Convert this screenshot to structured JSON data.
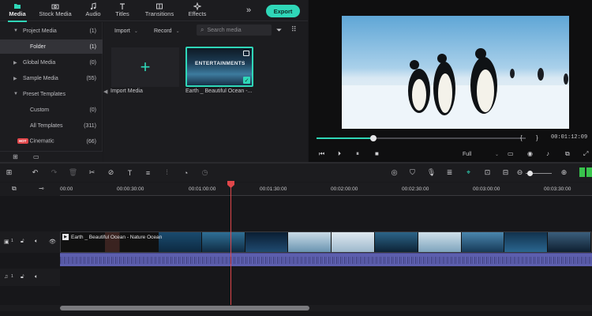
{
  "tabs": [
    {
      "label": "Media",
      "icon": "folder-icon",
      "active": true
    },
    {
      "label": "Stock Media",
      "icon": "camera-icon",
      "active": false
    },
    {
      "label": "Audio",
      "icon": "music-note-icon",
      "active": false
    },
    {
      "label": "Titles",
      "icon": "text-t-icon",
      "active": false
    },
    {
      "label": "Transitions",
      "icon": "transition-icon",
      "active": false
    },
    {
      "label": "Effects",
      "icon": "sparkle-icon",
      "active": false
    }
  ],
  "toolbar": {
    "more": "»",
    "export_label": "Export"
  },
  "sidebar": {
    "items": [
      {
        "label": "Project Media",
        "count": "(1)",
        "caret": "▼"
      },
      {
        "label": "Folder",
        "count": "(1)",
        "caret": ""
      },
      {
        "label": "Global Media",
        "count": "(0)",
        "caret": "▶"
      },
      {
        "label": "Sample Media",
        "count": "(55)",
        "caret": "▶"
      },
      {
        "label": "Preset Templates",
        "count": "",
        "caret": "▼"
      },
      {
        "label": "Custom",
        "count": "(0)",
        "caret": ""
      },
      {
        "label": "All Templates",
        "count": "(311)",
        "caret": ""
      },
      {
        "label": "Cinematic",
        "count": "(66)",
        "caret": "",
        "badge": "HOT"
      }
    ]
  },
  "media": {
    "import_label": "Import",
    "record_label": "Record",
    "search_placeholder": "Search media",
    "import_tile_label": "Import Media",
    "clip_label": "Earth _ Beautiful Ocean -...",
    "clip_thumb_text": "ENTERTAINMENTS"
  },
  "preview": {
    "brackets_open": "{",
    "brackets_close": "}",
    "timecode": "00:01:12:09",
    "quality": "Full",
    "progress": 0.27
  },
  "ruler": {
    "ticks": [
      "00:00",
      "00:00:30:00",
      "00:01:00:00",
      "00:01:30:00",
      "00:02:00:00",
      "00:02:30:00",
      "00:03:00:00",
      "00:03:30:00"
    ]
  },
  "timeline": {
    "video_track_num": "1",
    "audio_track_num": "1",
    "clip_title": "Earth _ Beautiful Ocean - Nature Ocean"
  },
  "colors": {
    "accent": "#2fd7b8",
    "playhead": "#e0464a",
    "audio": "#5d5fae"
  }
}
